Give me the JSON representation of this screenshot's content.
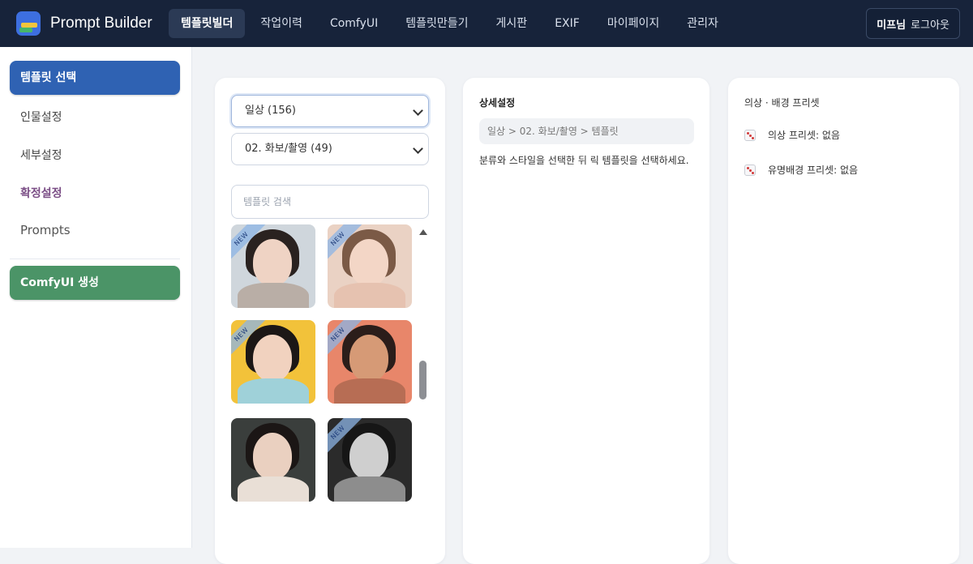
{
  "app": {
    "name": "Prompt Builder"
  },
  "nav": {
    "items": [
      {
        "label": "템플릿빌더",
        "active": true
      },
      {
        "label": "작업이력"
      },
      {
        "label": "ComfyUI"
      },
      {
        "label": "템플릿만들기"
      },
      {
        "label": "게시판"
      },
      {
        "label": "EXIF"
      },
      {
        "label": "마이페이지"
      },
      {
        "label": "관리자"
      }
    ]
  },
  "user": {
    "name": "미프님",
    "logout_label": "로그아웃"
  },
  "sidebar": {
    "items": [
      {
        "label": "템플릿 선택",
        "selected": true
      },
      {
        "label": "인물설정"
      },
      {
        "label": "세부설정"
      },
      {
        "label": "확정설정"
      },
      {
        "label": "Prompts"
      }
    ],
    "generate_label": "ComfyUI 생성"
  },
  "template_panel": {
    "category_select": "일상 (156)",
    "subcategory_select": "02. 화보/촬영 (49)",
    "search_placeholder": "템플릿 검색",
    "new_badge": "NEW",
    "thumbnails": [
      {
        "name": "portrait-1",
        "new": true,
        "bg": "#cfd6dc",
        "skin": "#efd3c4",
        "hair": "#2a2220",
        "body": "#b9aea6"
      },
      {
        "name": "portrait-2",
        "new": true,
        "bg": "#ead2c4",
        "skin": "#f3d6c6",
        "hair": "#7b5a46",
        "body": "#e6c2b0"
      },
      {
        "name": "portrait-3",
        "new": true,
        "bg": "#f2c23a",
        "skin": "#f1d2bf",
        "hair": "#1c1716",
        "body": "#9fd1d9"
      },
      {
        "name": "portrait-4",
        "new": true,
        "bg": "#e8866a",
        "skin": "#d69a76",
        "hair": "#2b1d1a",
        "body": "#b76d54"
      },
      {
        "name": "portrait-5",
        "new": false,
        "bg": "#3a3e3c",
        "skin": "#ead0c0",
        "hair": "#1b1615",
        "body": "#e9dfd6"
      },
      {
        "name": "portrait-6",
        "new": true,
        "bg": "#2b2b2b",
        "skin": "#cfcfcf",
        "hair": "#161616",
        "body": "#8d8d8d"
      }
    ]
  },
  "detail_panel": {
    "title": "상세설정",
    "breadcrumb": "일상 > 02. 화보/촬영 > 템플릿",
    "help_text": "분류와 스타일을 선택한 뒤 릭 템플릿을 선택하세요."
  },
  "preset_panel": {
    "title": "의상 · 배경 프리셋",
    "rows": [
      {
        "label": "의상 프리셋: 없음"
      },
      {
        "label": "유명배경 프리셋: 없음"
      }
    ]
  }
}
